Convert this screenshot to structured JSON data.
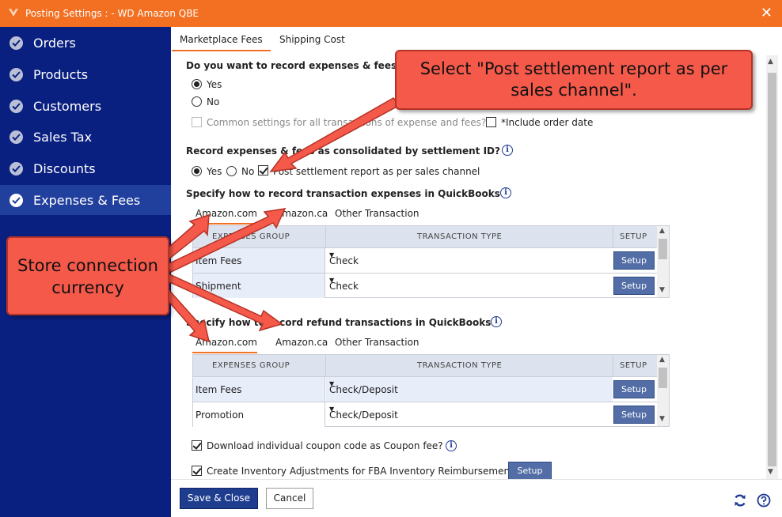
{
  "window": {
    "title": "Posting Settings : - WD Amazon QBE",
    "close": "✕"
  },
  "sidebar": {
    "items": [
      {
        "label": "Orders"
      },
      {
        "label": "Products"
      },
      {
        "label": "Customers"
      },
      {
        "label": "Sales Tax"
      },
      {
        "label": "Discounts"
      },
      {
        "label": "Expenses & Fees",
        "active": true
      }
    ]
  },
  "tabs": [
    {
      "label": "Marketplace Fees",
      "active": true
    },
    {
      "label": "Shipping Cost"
    }
  ],
  "q1": {
    "text": "Do you want to record expenses & fees?",
    "yes": "Yes",
    "no": "No",
    "selected": "Yes"
  },
  "common": {
    "label": "Common settings for all transactions of expense and fees?",
    "include_date": "*Include order date"
  },
  "q2": {
    "text": "Record expenses & fees as consolidated by settlement ID?",
    "yes": "Yes",
    "no": "No",
    "post_label": "Post settlement report as per sales channel",
    "post_checked": true
  },
  "section1": {
    "title": "Specify how to record transaction expenses in QuickBooks",
    "subtabs": [
      "Amazon.com",
      "Amazon.ca",
      "Other Transaction"
    ],
    "headers": [
      "EXPENSES GROUP",
      "TRANSACTION TYPE",
      "SETUP"
    ],
    "rows": [
      {
        "group": "Item Fees",
        "type": "Check",
        "setup": "Setup"
      },
      {
        "group": "Shipment",
        "type": "Check",
        "setup": "Setup"
      }
    ]
  },
  "section2": {
    "title": "Specify how to record refund transactions in QuickBooks",
    "subtabs": [
      "Amazon.com",
      "Amazon.ca",
      "Other Transaction"
    ],
    "headers": [
      "EXPENSES GROUP",
      "TRANSACTION TYPE",
      "SETUP"
    ],
    "rows": [
      {
        "group": "Item Fees",
        "type": "Check/Deposit",
        "setup": "Setup"
      },
      {
        "group": "Promotion",
        "type": "Check/Deposit",
        "setup": "Setup"
      }
    ]
  },
  "coupon": {
    "label": "Download individual coupon code as Coupon fee?",
    "checked": true
  },
  "fba": {
    "label": "Create Inventory Adjustments for FBA Inventory Reimbursement",
    "checked": true,
    "setup": "Setup"
  },
  "footer": {
    "save": "Save & Close",
    "cancel": "Cancel"
  },
  "callouts": {
    "top": "Select \"Post settlement report as per sales channel\".",
    "left": "Store connection currency"
  },
  "colors": {
    "titlebar": "#f36f21",
    "sidebar": "#0a2080",
    "accent": "#f36f21",
    "button": "#1f3d8f",
    "callout": "#f5594a"
  }
}
